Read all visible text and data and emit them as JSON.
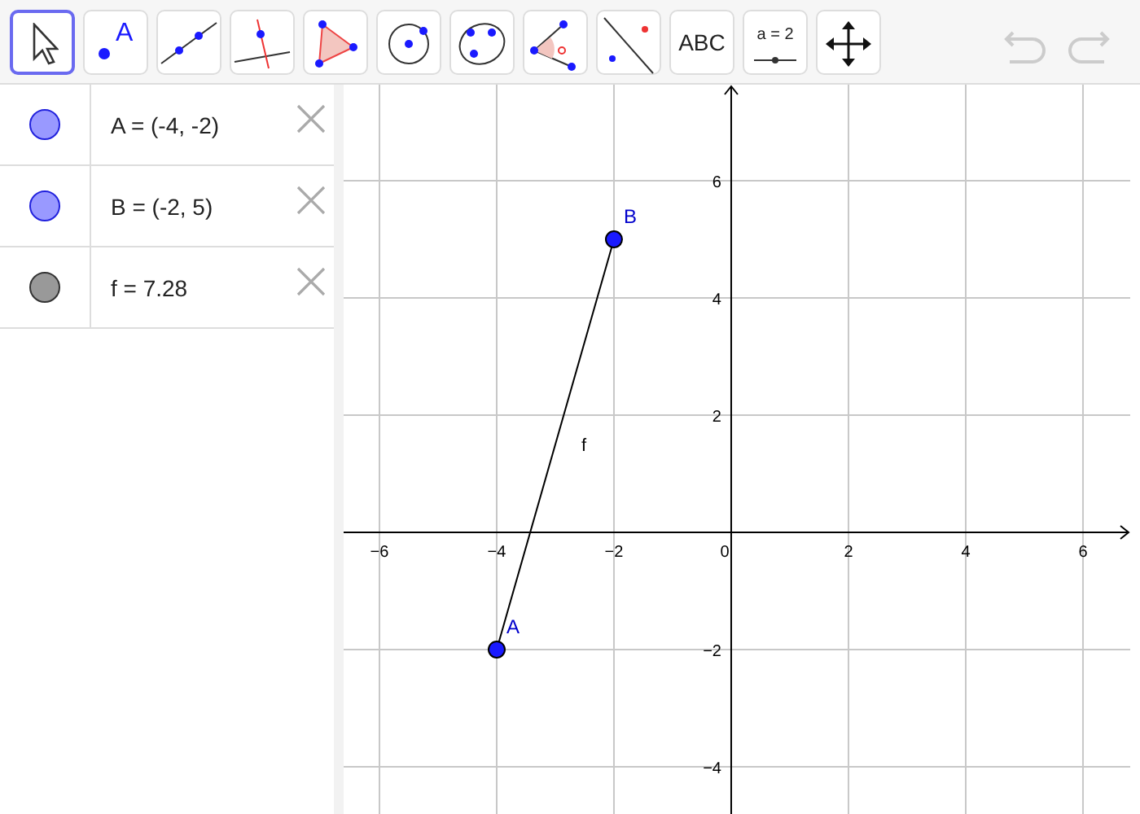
{
  "toolbar": {
    "tools": [
      {
        "kind": "move",
        "selected": true
      },
      {
        "kind": "point",
        "label": "A",
        "selected": false
      },
      {
        "kind": "line",
        "selected": false
      },
      {
        "kind": "perpendicular",
        "selected": false
      },
      {
        "kind": "polygon",
        "selected": false
      },
      {
        "kind": "circle",
        "selected": false
      },
      {
        "kind": "conic",
        "selected": false
      },
      {
        "kind": "angle",
        "selected": false
      },
      {
        "kind": "reflect",
        "selected": false
      },
      {
        "kind": "text",
        "label": "ABC",
        "selected": false
      },
      {
        "kind": "slider",
        "label": "a = 2",
        "selected": false
      },
      {
        "kind": "pan",
        "selected": false
      }
    ],
    "history": [
      {
        "kind": "undo",
        "disabled": true
      },
      {
        "kind": "redo",
        "disabled": true
      }
    ]
  },
  "algebra": {
    "items": [
      {
        "text": "A = (-4, -2)",
        "color": "#9999ff"
      },
      {
        "text": "B = (-2, 5)",
        "color": "#9999ff"
      },
      {
        "text": "f = 7.28",
        "color": "#999999"
      }
    ]
  },
  "graphics": {
    "chart_data": {
      "type": "line",
      "x": [
        -4,
        -2
      ],
      "series": [
        {
          "name": "f",
          "color": "#000000",
          "marker": "circle",
          "values": [
            -2,
            5
          ]
        }
      ],
      "grid": true,
      "xlim": [
        -6.611,
        6.806
      ],
      "ylim": [
        -4.806,
        7.639
      ],
      "xticks": [
        -6,
        -4,
        -2,
        0,
        2,
        4,
        6
      ],
      "yticks": [
        -4,
        -2,
        2,
        4,
        6
      ],
      "annotations": [
        {
          "text": "A",
          "x": -4,
          "y": -2
        },
        {
          "text": "B",
          "x": -2,
          "y": 5
        }
      ]
    }
  }
}
